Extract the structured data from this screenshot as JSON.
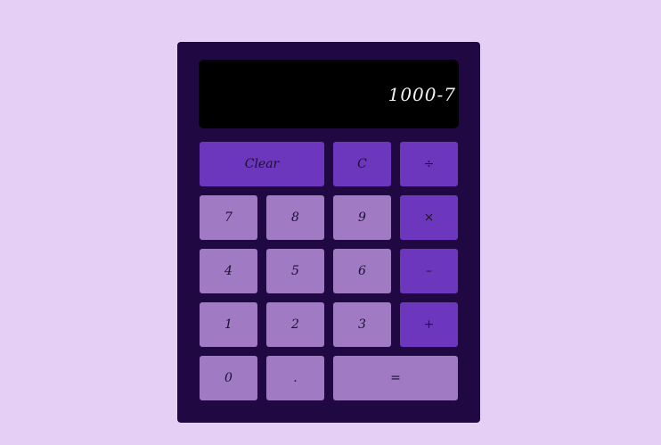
{
  "display": {
    "value": "1000-7"
  },
  "keys": {
    "clear": "Clear",
    "c": "C",
    "divide": "÷",
    "seven": "7",
    "eight": "8",
    "nine": "9",
    "multiply": "×",
    "four": "4",
    "five": "5",
    "six": "6",
    "minus": "–",
    "one": "1",
    "two": "2",
    "three": "3",
    "plus": "+",
    "zero": "0",
    "dot": ".",
    "equals": "="
  },
  "colors": {
    "page_background": "#e6cff5",
    "body": "#200843",
    "display": "#000000",
    "operator_key": "#6d37bd",
    "number_key": "#a07bc4"
  }
}
